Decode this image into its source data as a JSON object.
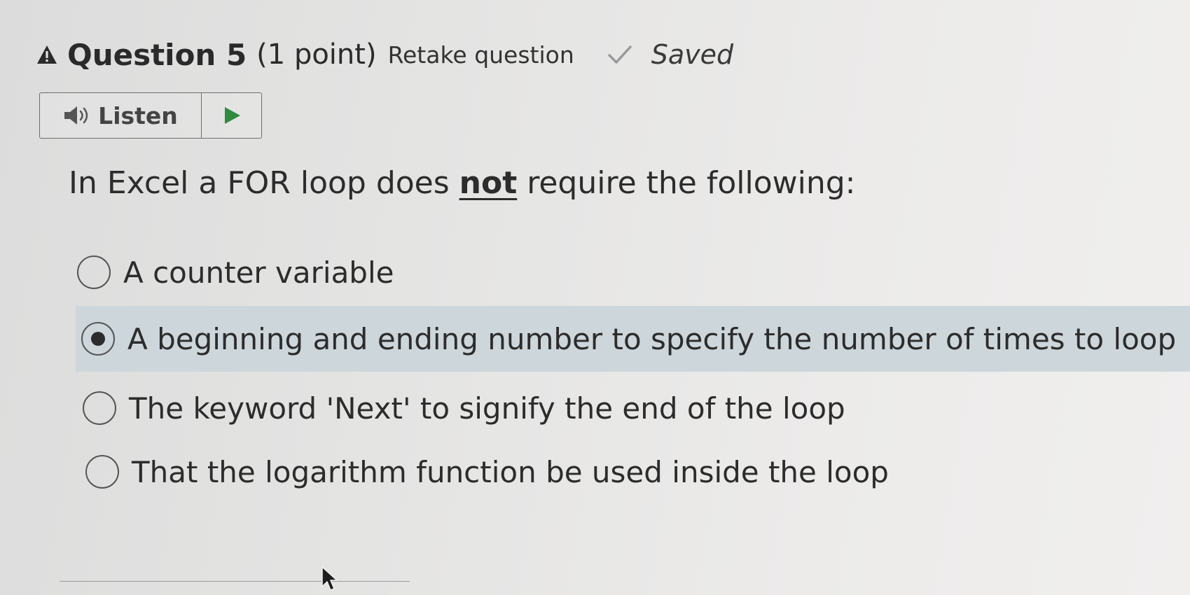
{
  "header": {
    "warning_icon": "warning-triangle-icon",
    "title": "Question 5",
    "points": "(1 point)",
    "retake_label": "Retake question",
    "check_icon": "checkmark-icon",
    "status": "Saved"
  },
  "listen": {
    "speaker_icon": "speaker-icon",
    "label": "Listen",
    "play_icon": "play-icon"
  },
  "question": {
    "prompt_before": "In Excel a FOR loop does ",
    "prompt_emphasis": "not",
    "prompt_after": " require the following:"
  },
  "options": [
    {
      "label": "A counter variable",
      "selected": false
    },
    {
      "label": "A beginning and ending number to specify the number of times to loop",
      "selected": true
    },
    {
      "label": "The keyword 'Next' to signify the end of the loop",
      "selected": false
    },
    {
      "label": "That the logarithm function be used inside the loop",
      "selected": false
    }
  ],
  "colors": {
    "selected_row": "#cdd6db",
    "play_accent": "#2e8b3d",
    "text": "#2c2c2c"
  }
}
